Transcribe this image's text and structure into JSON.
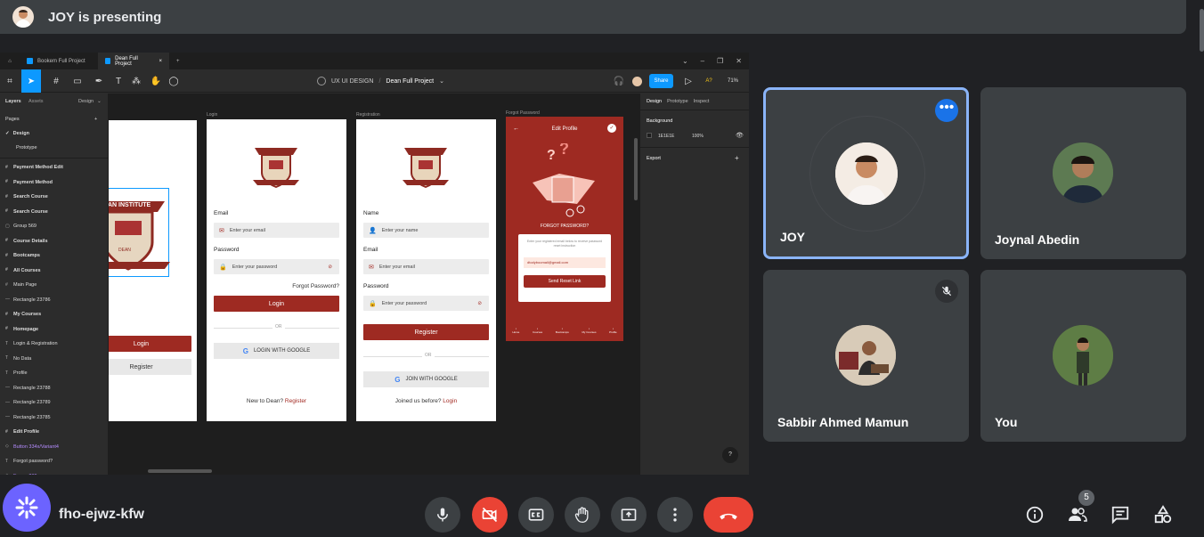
{
  "presenting": {
    "text": "JOY is presenting",
    "avatar": "person-avatar"
  },
  "figma": {
    "tabs": [
      {
        "label": "Bookem Full Project"
      },
      {
        "label": "Dean Full Project"
      }
    ],
    "new_tab": "+",
    "breadcrumb": {
      "team": "UX UI DESIGN",
      "sep": "/",
      "file": "Dean Full Project"
    },
    "share": "Share",
    "zoom": "71%",
    "left_tabs": {
      "layers": "Layers",
      "assets": "Assets",
      "page_menu": "Design"
    },
    "pages_label": "Pages",
    "pages": [
      "Design",
      "Prototype"
    ],
    "layers": [
      "Payment Method Edit",
      "Payment Method",
      "Search Course",
      "Search Course",
      "Group 569",
      "Course Details",
      "Bootcamps",
      "All Courses",
      "Main Page",
      "Rectangle 23786",
      "My Courses",
      "Homepage",
      "Login & Registration",
      "No Data",
      "Profile",
      "Rectangle 23788",
      "Rectangle 23789",
      "Rectangle 23785",
      "Edit Profile",
      "Button 334x/Variant4",
      "Forgot password?",
      "Frame 289"
    ],
    "right_tabs": [
      "Design",
      "Prototype",
      "Inspect"
    ],
    "background_label": "Background",
    "bg_hex": "1E1E1E",
    "bg_opacity": "100%",
    "export_label": "Export",
    "help": "?",
    "frames": {
      "login_label": "Login",
      "registration_label": "Registration",
      "forgot_label": "Forgot Password",
      "logo_text": "DEAN INSTITUTE",
      "logo_sub": "DEAN INSTITUTE",
      "partial": {
        "login": "Login",
        "register": "Register"
      },
      "login": {
        "email_label": "Email",
        "email_ph": "Enter your email",
        "password_label": "Password",
        "password_ph": "Enter your password",
        "forgot": "Forgot Password?",
        "login_btn": "Login",
        "or": "OR",
        "google": "LOGIN WITH GOOGLE",
        "new_text": "New to Dean?",
        "register_link": "Register"
      },
      "register": {
        "name_label": "Name",
        "name_ph": "Enter your name",
        "email_label": "Email",
        "email_ph": "Enter your email",
        "password_label": "Password",
        "password_ph": "Enter your password",
        "register_btn": "Register",
        "or": "OR",
        "google": "JOIN WITH GOOGLE",
        "joined_text": "Joined us before?",
        "login_link": "Login"
      },
      "forgot": {
        "header": "Edit Profile",
        "heading": "FORGOT PASSWORD?",
        "desc": "Enter your registered email below to receive password reset instruction",
        "email": "dtodyboomail@gmail.com",
        "send_btn": "Send Reset Link",
        "nav": [
          "Home",
          "Courses",
          "Bootcamps",
          "My Courses",
          "Profile"
        ]
      }
    }
  },
  "participants": [
    {
      "name": "JOY"
    },
    {
      "name": "Joynal Abedin"
    },
    {
      "name": "Sabbir Ahmed Mamun"
    },
    {
      "name": "You"
    }
  ],
  "meeting": {
    "code": "fho-ejwz-kfw",
    "people_count": "5"
  },
  "colors": {
    "accent": "#8ab4f8",
    "brand_red": "#9e2a22",
    "danger": "#ea4335",
    "figma_blue": "#0d99ff"
  }
}
